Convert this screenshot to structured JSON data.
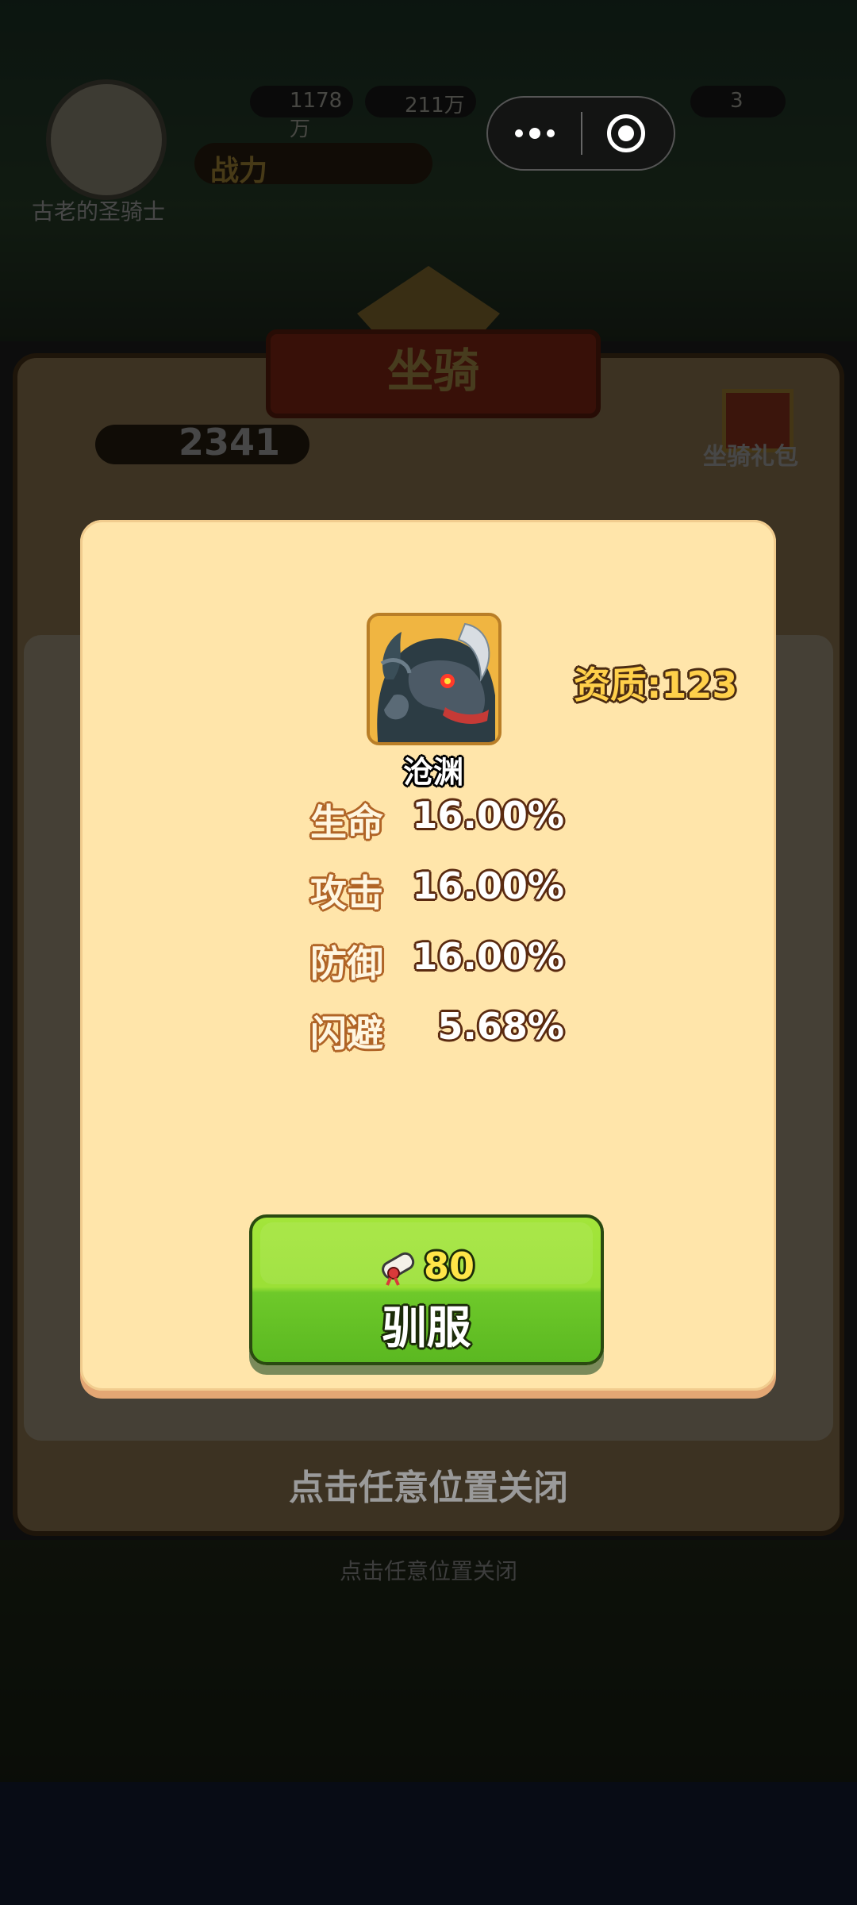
{
  "background": {
    "player_name": "古老的圣骑士",
    "resources": [
      "1178万",
      "211万",
      "3"
    ],
    "power_label": "战力",
    "panel_title": "坐骑",
    "meat_count": "2341",
    "gift_label": "坐骑礼包"
  },
  "dialog": {
    "mount_name": "沧渊",
    "aptitude": "资质:123",
    "stats": [
      {
        "label": "生命",
        "value": "16.00%"
      },
      {
        "label": "攻击",
        "value": "16.00%"
      },
      {
        "label": "防御",
        "value": "16.00%"
      },
      {
        "label": "闪避",
        "value": "5.68%"
      }
    ],
    "tame_button": {
      "cost": "80",
      "cost_icon": "scroll-icon",
      "label": "驯服"
    }
  },
  "close_hint": "点击任意位置关闭",
  "close_hint_bg": "点击任意位置关闭",
  "colors": {
    "dialog_bg": "#ffe5aa",
    "button_green": "#9be036",
    "aptitude_gold": "#ffd04a"
  }
}
